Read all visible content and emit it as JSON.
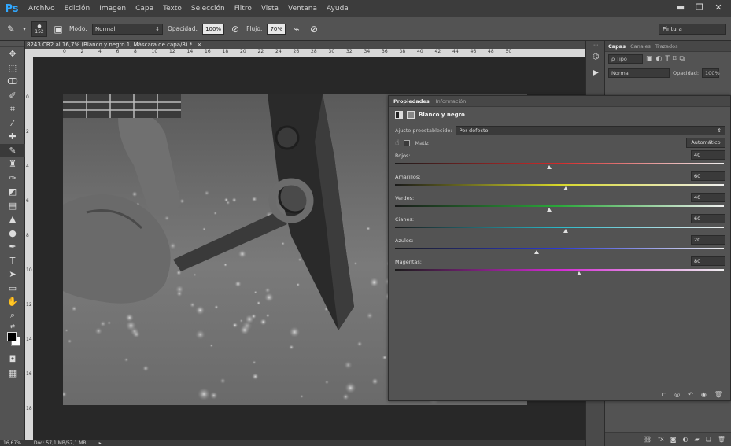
{
  "app": {
    "logo": "Ps"
  },
  "menu": [
    "Archivo",
    "Edición",
    "Imagen",
    "Capa",
    "Texto",
    "Selección",
    "Filtro",
    "Vista",
    "Ventana",
    "Ayuda"
  ],
  "window_controls": [
    "minimize-icon",
    "restore-icon",
    "close-icon"
  ],
  "options_bar": {
    "brush_size": "152",
    "mode_label": "Modo:",
    "mode_value": "Normal",
    "opacity_label": "Opacidad:",
    "opacity_value": "100%",
    "flow_label": "Flujo:",
    "flow_value": "70%",
    "workspace": "Pintura"
  },
  "tools": [
    "move-tool-icon",
    "marquee-tool-icon",
    "lasso-tool-icon",
    "quick-select-tool-icon",
    "crop-tool-icon",
    "eyedropper-tool-icon",
    "healing-brush-tool-icon",
    "brush-tool-icon",
    "clone-stamp-tool-icon",
    "history-brush-tool-icon",
    "eraser-tool-icon",
    "gradient-tool-icon",
    "blur-tool-icon",
    "dodge-tool-icon",
    "pen-tool-icon",
    "type-tool-icon",
    "path-select-tool-icon",
    "shape-tool-icon",
    "hand-tool-icon",
    "zoom-tool-icon"
  ],
  "document": {
    "tab_title": "8243.CR2 al 16,7% (Blanco y negro 1, Máscara de capa/8) *",
    "ruler_numbers": [
      "0",
      "2",
      "4",
      "6",
      "8",
      "10",
      "12",
      "14",
      "16",
      "18",
      "20",
      "22",
      "24",
      "26",
      "28",
      "30",
      "32",
      "34",
      "36",
      "38",
      "40",
      "42",
      "44",
      "46",
      "48",
      "50"
    ],
    "ruler_v_numbers": [
      "0",
      "2",
      "4",
      "6",
      "8",
      "10",
      "12",
      "14",
      "16",
      "18"
    ]
  },
  "statusbar": {
    "zoom": "16,67%",
    "doc": "Doc: 57,1 MB/57,1 MB"
  },
  "layers_panel": {
    "tabs": [
      "Capas",
      "Canales",
      "Trazados"
    ],
    "active_tab": 0,
    "filter_label": "ρ Tipo",
    "blend_mode": "Normal",
    "opacity_label": "Opacidad:",
    "opacity_value": "100%"
  },
  "properties_panel": {
    "tabs": [
      "Propiedades",
      "Información"
    ],
    "active_tab": 0,
    "adjustment_name": "Blanco y negro",
    "preset_label": "Ajuste preestablecido:",
    "preset_value": "Por defecto",
    "tint_label": "Matiz",
    "tint_checked": false,
    "auto_button": "Automático",
    "sliders": [
      {
        "label": "Rojos:",
        "value": "40",
        "color": "#d42a2a",
        "fraction": 0.47
      },
      {
        "label": "Amarillos:",
        "value": "60",
        "color": "#d8d82a",
        "fraction": 0.52
      },
      {
        "label": "Verdes:",
        "value": "40",
        "color": "#2aa83a",
        "fraction": 0.47
      },
      {
        "label": "Cianes:",
        "value": "60",
        "color": "#2ab8c8",
        "fraction": 0.52
      },
      {
        "label": "Azules:",
        "value": "20",
        "color": "#2a3ad8",
        "fraction": 0.43
      },
      {
        "label": "Magentas:",
        "value": "80",
        "color": "#d42ad4",
        "fraction": 0.56
      }
    ]
  }
}
